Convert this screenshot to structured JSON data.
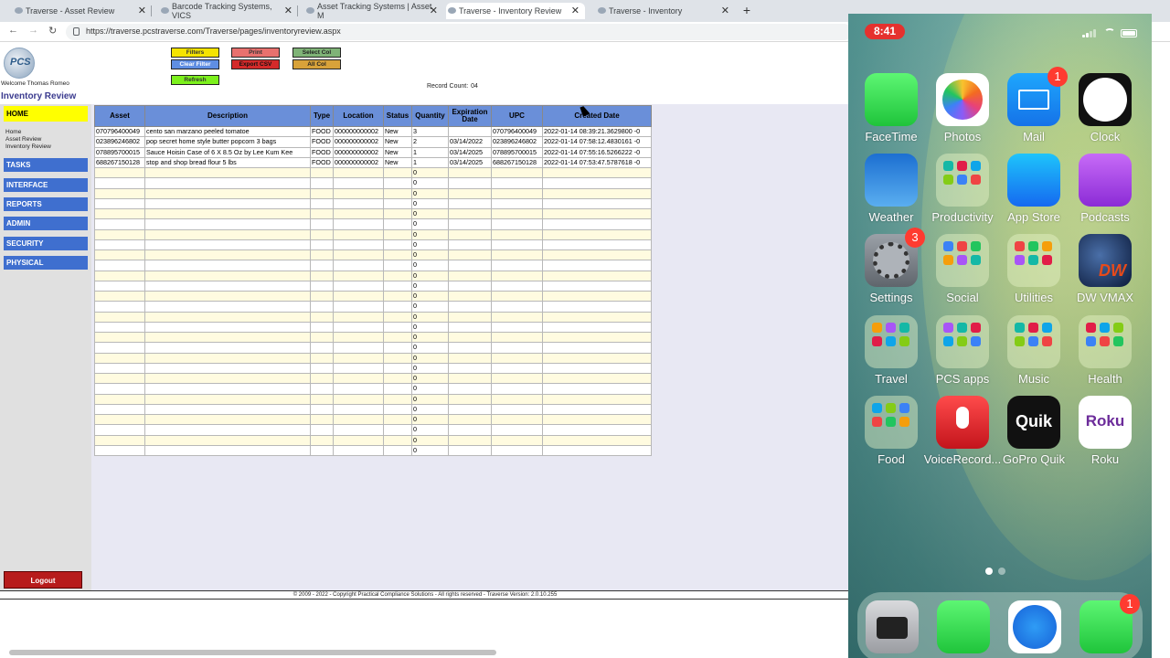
{
  "browser": {
    "tabs": [
      {
        "title": "Traverse - Asset Review",
        "active": false
      },
      {
        "title": "Barcode Tracking Systems, VICS",
        "active": false
      },
      {
        "title": "Asset Tracking Systems | Asset M",
        "active": false
      },
      {
        "title": "Traverse - Inventory Review",
        "active": true
      },
      {
        "title": "Traverse - Inventory",
        "active": false
      }
    ],
    "close_glyph": "✕",
    "new_tab_glyph": "+",
    "url": "https://traverse.pcstraverse.com/Traverse/pages/inventoryreview.aspx",
    "nav": {
      "back": "←",
      "forward": "→",
      "reload": "↻"
    }
  },
  "header": {
    "logo_text": "PCS",
    "welcome": "Welcome Thomas Romeo",
    "page_title": "Inventory Review",
    "record_count_label": "Record Count:",
    "record_count_value": "04",
    "buttons": {
      "filters": "Filters",
      "clear_filter": "Clear Filter",
      "refresh": "Refresh",
      "print": "Print",
      "export_csv": "Export CSV",
      "select_col": "Select Col",
      "all_col": "All Col"
    },
    "button_colors": {
      "filters": "#f5e300",
      "clear_filter": "#5f8ee3",
      "refresh": "#7cf01c",
      "print": "#e8716e",
      "export_csv": "#d42a2a",
      "select_col": "#7fb377",
      "all_col": "#d8a23a"
    }
  },
  "sidebar": {
    "home": "HOME",
    "sub_links": [
      "Home",
      "Asset Review",
      "Inventory Review"
    ],
    "items": [
      "TASKS",
      "INTERFACE",
      "REPORTS",
      "ADMIN",
      "SECURITY",
      "PHYSICAL"
    ],
    "logout": "Logout"
  },
  "table": {
    "columns": [
      "Asset",
      "Description",
      "Type",
      "Location",
      "Status",
      "Quantity",
      "Expiration Date",
      "UPC",
      "Created Date"
    ],
    "rows": [
      [
        "070796400049",
        "cento san marzano peeled tomatoe",
        "FOOD",
        "000000000002",
        "New",
        "3",
        "",
        "070796400049",
        "2022-01-14 08:39:21.3629800 -0"
      ],
      [
        "023896246802",
        "pop secret home style butter popcorn 3 bags",
        "FOOD",
        "000000000002",
        "New",
        "2",
        "03/14/2022",
        "023896246802",
        "2022-01-14 07:58:12.4830161 -0"
      ],
      [
        "078895700015",
        "Sauce Hoisin Case of 6 X 8.5 Oz by Lee Kum Kee",
        "FOOD",
        "000000000002",
        "New",
        "1",
        "03/14/2025",
        "078895700015",
        "2022-01-14 07:55:16.5266222 -0"
      ],
      [
        "688267150128",
        "stop and shop bread flour 5 lbs",
        "FOOD",
        "000000000002",
        "New",
        "1",
        "03/14/2025",
        "688267150128",
        "2022-01-14 07:53:47.5787618 -0"
      ]
    ],
    "empty_quantity": "0",
    "empty_row_count": 28
  },
  "footer": "© 2009 - 2022 - Copyright Practical Compliance Solutions - All rights reserved - Traverse Version: 2.0.10.255",
  "phone": {
    "time": "8:41",
    "apps": [
      {
        "label": "FaceTime",
        "icon": "facetime-icon",
        "badge": ""
      },
      {
        "label": "Photos",
        "icon": "photos-icon",
        "badge": ""
      },
      {
        "label": "Mail",
        "icon": "mail-icon",
        "badge": "1"
      },
      {
        "label": "Clock",
        "icon": "clock-icon",
        "badge": ""
      },
      {
        "label": "Weather",
        "icon": "weather-icon",
        "badge": ""
      },
      {
        "label": "Productivity",
        "icon": "folder-icon",
        "badge": ""
      },
      {
        "label": "App Store",
        "icon": "app-store-icon",
        "badge": ""
      },
      {
        "label": "Podcasts",
        "icon": "podcasts-icon",
        "badge": ""
      },
      {
        "label": "Settings",
        "icon": "settings-icon",
        "badge": "3"
      },
      {
        "label": "Social",
        "icon": "folder-icon",
        "badge": ""
      },
      {
        "label": "Utilities",
        "icon": "folder-icon",
        "badge": ""
      },
      {
        "label": "DW VMAX",
        "icon": "dw-vmax-icon",
        "badge": ""
      },
      {
        "label": "Travel",
        "icon": "folder-icon",
        "badge": ""
      },
      {
        "label": "PCS apps",
        "icon": "folder-icon",
        "badge": ""
      },
      {
        "label": "Music",
        "icon": "folder-icon",
        "badge": ""
      },
      {
        "label": "Health",
        "icon": "folder-icon",
        "badge": ""
      },
      {
        "label": "Food",
        "icon": "folder-icon",
        "badge": ""
      },
      {
        "label": "VoiceRecord...",
        "icon": "voice-recorder-icon",
        "badge": ""
      },
      {
        "label": "GoPro Quik",
        "icon": "gopro-quik-icon",
        "badge": ""
      },
      {
        "label": "Roku",
        "icon": "roku-icon",
        "badge": ""
      }
    ],
    "icon_text": {
      "quik": "Quik",
      "roku": "Roku",
      "dw": "DW"
    },
    "dock": [
      {
        "name": "camera-icon",
        "badge": ""
      },
      {
        "name": "phone-icon",
        "badge": ""
      },
      {
        "name": "safari-icon",
        "badge": ""
      },
      {
        "name": "messages-icon",
        "badge": "1"
      }
    ]
  }
}
